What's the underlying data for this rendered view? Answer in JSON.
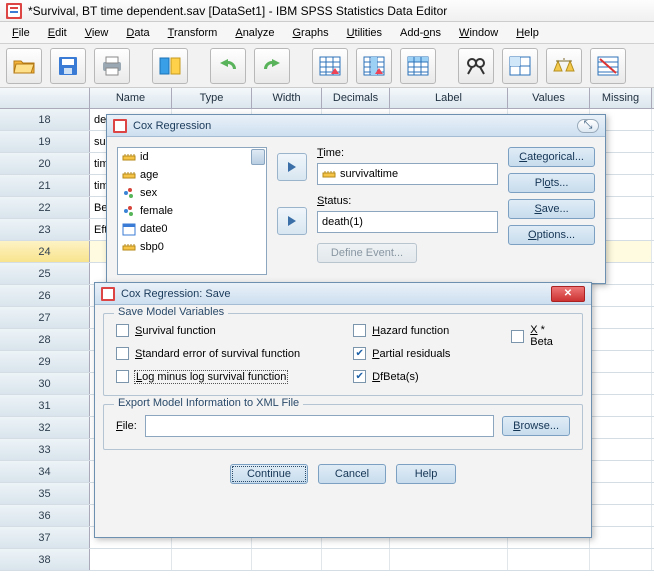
{
  "app": {
    "title": "*Survival, BT time dependent.sav [DataSet1] - IBM SPSS Statistics Data Editor"
  },
  "menu": [
    "File",
    "Edit",
    "View",
    "Data",
    "Transform",
    "Analyze",
    "Graphs",
    "Utilities",
    "Add-ons",
    "Window",
    "Help"
  ],
  "columns": [
    "Name",
    "Type",
    "Width",
    "Decimals",
    "Label",
    "Values",
    "Missing"
  ],
  "rows": [
    {
      "n": "18",
      "name": "deat"
    },
    {
      "n": "19",
      "name": "surv"
    },
    {
      "n": "20",
      "name": "time"
    },
    {
      "n": "21",
      "name": "time"
    },
    {
      "n": "22",
      "name": "Beh"
    },
    {
      "n": "23",
      "name": "Efte"
    },
    {
      "n": "24",
      "name": ""
    },
    {
      "n": "25",
      "name": ""
    },
    {
      "n": "26",
      "name": ""
    },
    {
      "n": "27",
      "name": ""
    },
    {
      "n": "28",
      "name": ""
    },
    {
      "n": "29",
      "name": ""
    },
    {
      "n": "30",
      "name": ""
    },
    {
      "n": "31",
      "name": ""
    },
    {
      "n": "32",
      "name": ""
    },
    {
      "n": "33",
      "name": ""
    },
    {
      "n": "34",
      "name": ""
    },
    {
      "n": "35",
      "name": ""
    },
    {
      "n": "36",
      "name": ""
    },
    {
      "n": "37",
      "name": ""
    },
    {
      "n": "38",
      "name": ""
    }
  ],
  "cox": {
    "title": "Cox Regression",
    "vars": [
      "id",
      "age",
      "sex",
      "female",
      "date0",
      "sbp0"
    ],
    "time_label": "Time:",
    "time_value": "survivaltime",
    "status_label": "Status:",
    "status_value": "death(1)",
    "define_event": "Define Event...",
    "buttons": {
      "categorical": "Categorical...",
      "plots": "Plots...",
      "save": "Save...",
      "options": "Options..."
    }
  },
  "save": {
    "title": "Cox Regression: Save",
    "group1": "Save Model Variables",
    "cb": {
      "survfn": "Survival function",
      "stderr": "Standard error of survival function",
      "loglog": "Log minus log survival function",
      "hazard": "Hazard function",
      "partial": "Partial residuals",
      "dfbeta": "DfBeta(s)",
      "xbeta": "X * Beta"
    },
    "checked": {
      "partial": true,
      "dfbeta": true
    },
    "group2": "Export Model Information to XML File",
    "file_label": "File:",
    "file_value": "",
    "browse": "Browse...",
    "continue": "Continue",
    "cancel": "Cancel",
    "help": "Help"
  }
}
